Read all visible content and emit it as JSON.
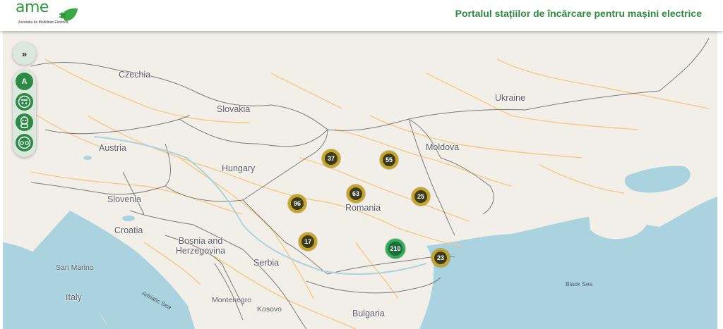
{
  "header": {
    "logo_text": "ame",
    "logo_subtitle": "Asociatia de Mobilitate Electrica",
    "title": "Portalul stațiilor de încărcare pentru mașini electrice"
  },
  "controls": {
    "expand_label": "»",
    "filters": [
      {
        "name": "filter-type-a",
        "label": "A",
        "icon": "letter-a"
      },
      {
        "name": "filter-type2",
        "label": "",
        "icon": "type2-connector-icon"
      },
      {
        "name": "filter-chademo",
        "label": "",
        "icon": "chademo-connector-icon"
      },
      {
        "name": "filter-ccs",
        "label": "",
        "icon": "ccs-connector-icon"
      }
    ]
  },
  "map": {
    "countries": [
      "Czechia",
      "Slovakia",
      "Ukraine",
      "Moldova",
      "Austria",
      "Hungary",
      "Romania",
      "Slovenia",
      "Croatia",
      "Bosnia and Herzegovina",
      "Serbia",
      "Italy",
      "Bulgaria",
      "Montenegro",
      "Kosovo",
      "San Marino"
    ],
    "seas": [
      "Black Sea",
      "Adriatic Sea"
    ],
    "colors": {
      "land": "#f2efe9",
      "water": "#aad3df",
      "road": "#f5c882",
      "border": "#555555",
      "cluster_fill": "#3a3a1e",
      "cluster_ring": "#c8a520",
      "cluster_green": "#2fae54"
    }
  },
  "clusters": [
    {
      "count": "37"
    },
    {
      "count": "55"
    },
    {
      "count": "63"
    },
    {
      "count": "96"
    },
    {
      "count": "25"
    },
    {
      "count": "17"
    },
    {
      "count": "210"
    },
    {
      "count": "23"
    }
  ]
}
